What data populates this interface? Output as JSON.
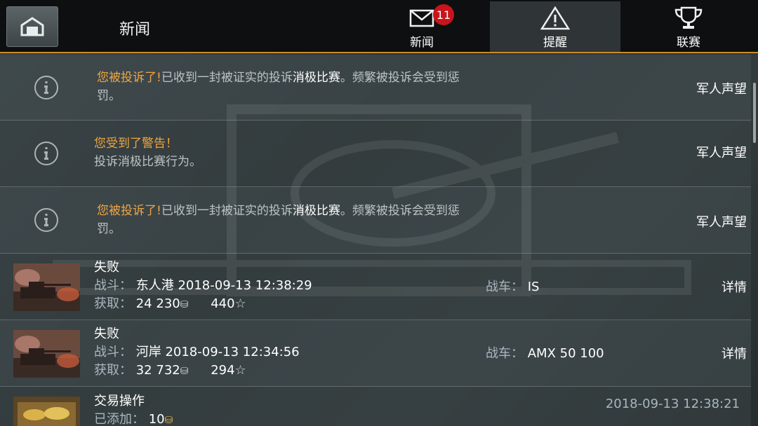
{
  "header": {
    "title": "新闻",
    "tabs": [
      {
        "label": "新闻",
        "icon": "mail-icon",
        "badge": "11"
      },
      {
        "label": "提醒",
        "icon": "warning-icon",
        "active": true
      },
      {
        "label": "联赛",
        "icon": "trophy-icon"
      }
    ]
  },
  "notifications": [
    {
      "title": "您被投诉了!",
      "text_a": "已收到一封被证实的投诉",
      "text_b": "消极比赛",
      "text_c": "。频繁被投诉会受到惩",
      "line2": "罚。",
      "right": "军人声望"
    },
    {
      "title": "您受到了警告！",
      "line2": "投诉消极比赛行为。",
      "right": "军人声望"
    },
    {
      "title": "您被投诉了!",
      "text_a": "已收到一封被证实的投诉",
      "text_b": "消极比赛",
      "text_c": "。频繁被投诉会受到惩",
      "line2": "罚。",
      "right": "军人声望"
    }
  ],
  "battles": [
    {
      "result": "失败",
      "battle_label": "战斗：",
      "battle_info": "东人港 2018-09-13 12:38:29",
      "earn_label": "获取：",
      "credits": "24 230",
      "xp": "440",
      "vehicle_label": "战车：",
      "vehicle": "IS",
      "details": "详情"
    },
    {
      "result": "失败",
      "battle_label": "战斗：",
      "battle_info": "河岸 2018-09-13 12:34:56",
      "earn_label": "获取：",
      "credits": "32 732",
      "xp": "294",
      "vehicle_label": "战车：",
      "vehicle": "AMX 50 100",
      "details": "详情"
    }
  ],
  "trade": {
    "title": "交易操作",
    "added_label": "已添加：",
    "amount": "10",
    "timestamp": "2018-09-13 12:38:21"
  },
  "colors": {
    "accent": "#c98a2c",
    "warning_text": "#f0a640",
    "badge": "#c8141b"
  }
}
